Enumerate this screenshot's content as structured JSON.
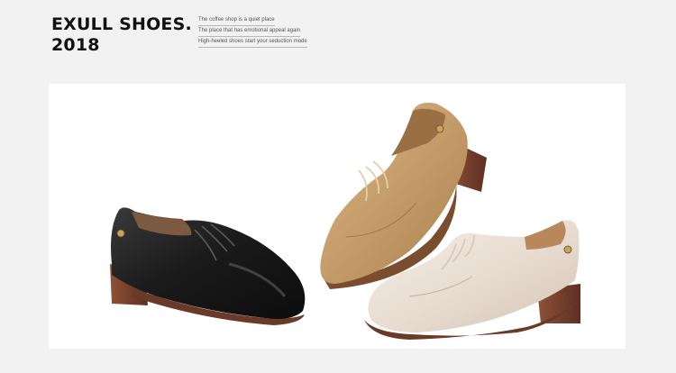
{
  "header": {
    "brand_line1": "EXULL SHOES.",
    "brand_line2": "2018",
    "tagline": [
      "The coffee shop is a quiet place",
      "The place that has emotional appeal again",
      "High-heeled shoes start your seduction mode"
    ]
  },
  "colors": {
    "black_shoe": "#1b1b1b",
    "tan_shoe": "#c49c69",
    "cream_shoe": "#e9ddd2",
    "heel_brown": "#7b4230",
    "background": "#f2f2f2",
    "panel": "#ffffff"
  }
}
